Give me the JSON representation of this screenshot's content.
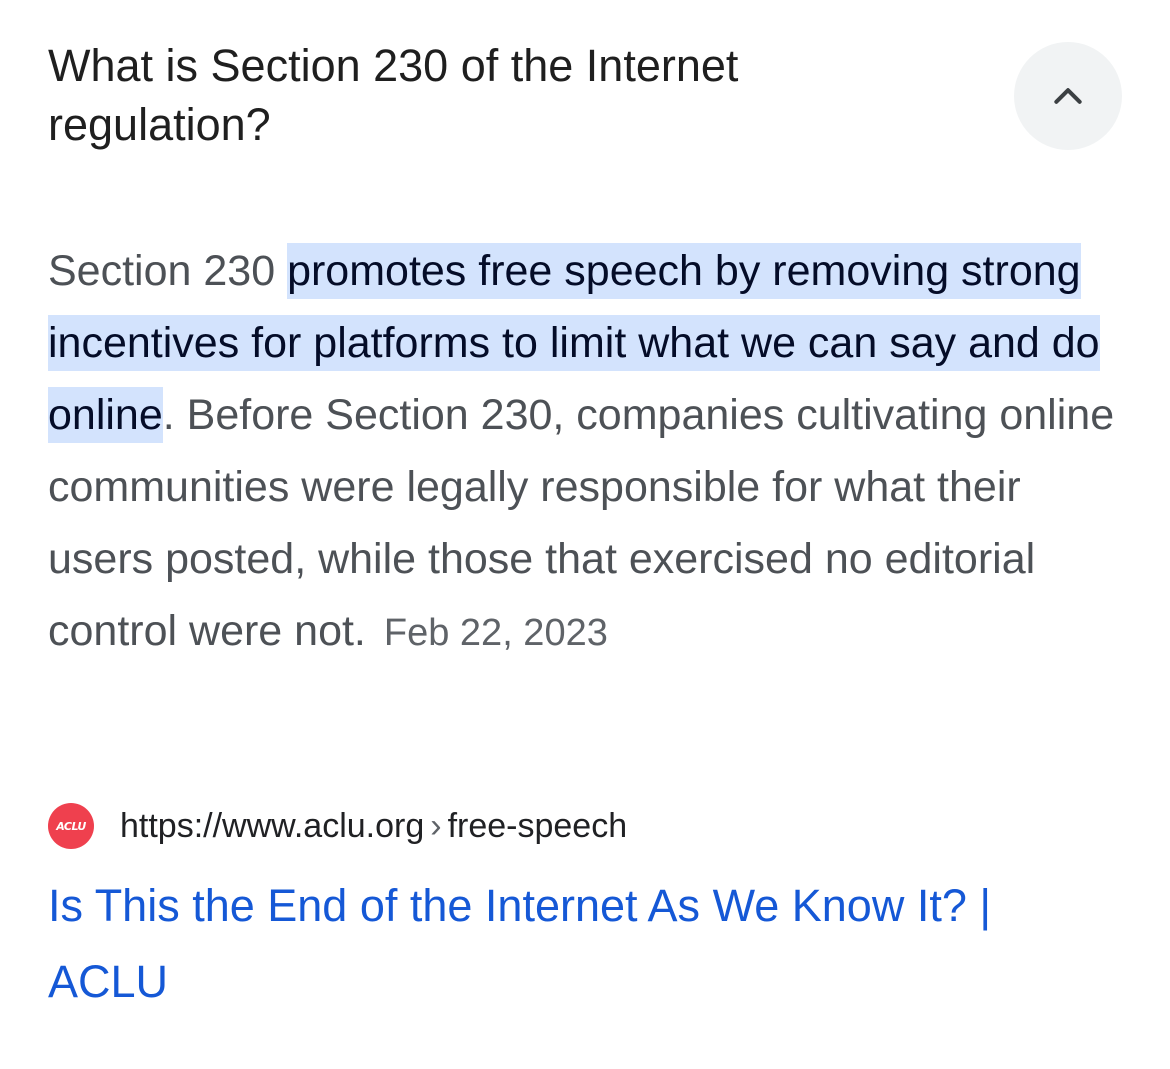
{
  "question": {
    "title": "What is Section 230 of the Internet regulation?"
  },
  "collapse_button": {
    "icon": "chevron-up-icon"
  },
  "answer": {
    "lead": "Section 230 ",
    "highlight": "promotes free speech by removing strong incentives for platforms to limit what we can say and do online",
    "rest": ". Before Section 230, companies cultivating online communities were legally responsible for what their users posted, while those that exercised no editorial control were not.",
    "date": "Feb 22, 2023"
  },
  "source": {
    "favicon_text": "ACLU",
    "url": "https://www.aclu.org",
    "separator": "›",
    "path": "free-speech"
  },
  "result": {
    "title": "Is This the End of the Internet As We Know It? | ACLU"
  },
  "colors": {
    "highlight_bg": "#d3e3fd",
    "link": "#1558d6",
    "favicon_bg": "#ef404e"
  }
}
